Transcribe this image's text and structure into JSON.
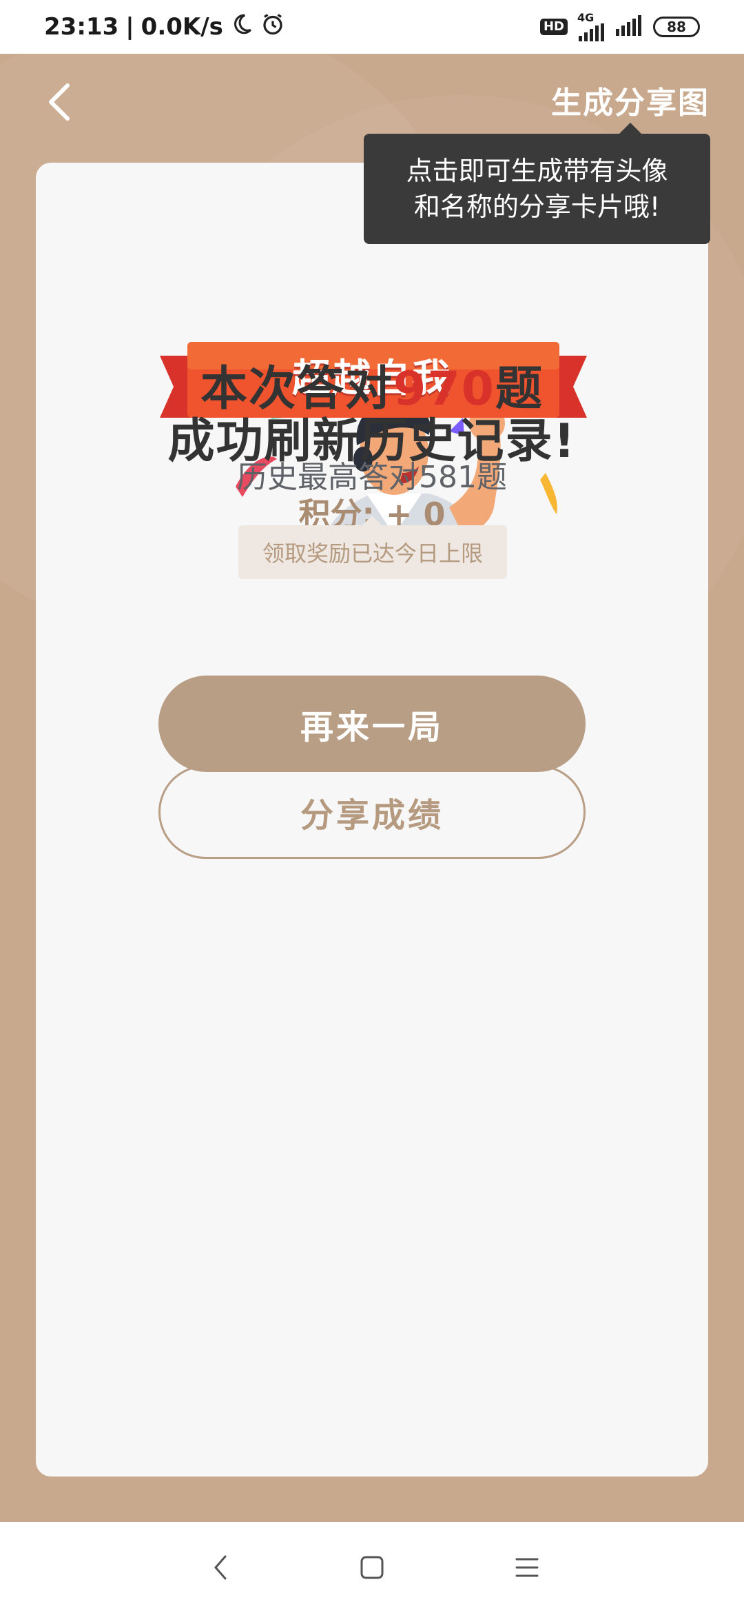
{
  "status_bar": {
    "time": "23:13",
    "separator": "|",
    "network_speed": "0.0K/s",
    "hd_label": "HD",
    "network_type": "4G",
    "battery": "88"
  },
  "header": {
    "back_icon": "chevron-left-icon",
    "share_image_label": "生成分享图"
  },
  "tooltip": {
    "line1": "点击即可生成带有头像",
    "line2": "和名称的分享卡片哦!"
  },
  "badge": {
    "banner_text": "超越自我"
  },
  "result": {
    "prefix": "本次答对",
    "count": "970",
    "suffix": "题",
    "record_text": "成功刷新历史记录!",
    "history_best": "历史最高答对581题",
    "points": "积分: + 0",
    "limit_note": "领取奖励已达今日上限"
  },
  "buttons": {
    "play_again": "再来一局",
    "share_score": "分享成绩"
  },
  "nav_bar": {
    "back_icon": "nav-back-icon",
    "home_icon": "nav-home-icon",
    "menu_icon": "nav-menu-icon"
  },
  "colors": {
    "page_background": "#c9a98e",
    "accent": "#b99e86",
    "highlight": "#d8322b"
  }
}
